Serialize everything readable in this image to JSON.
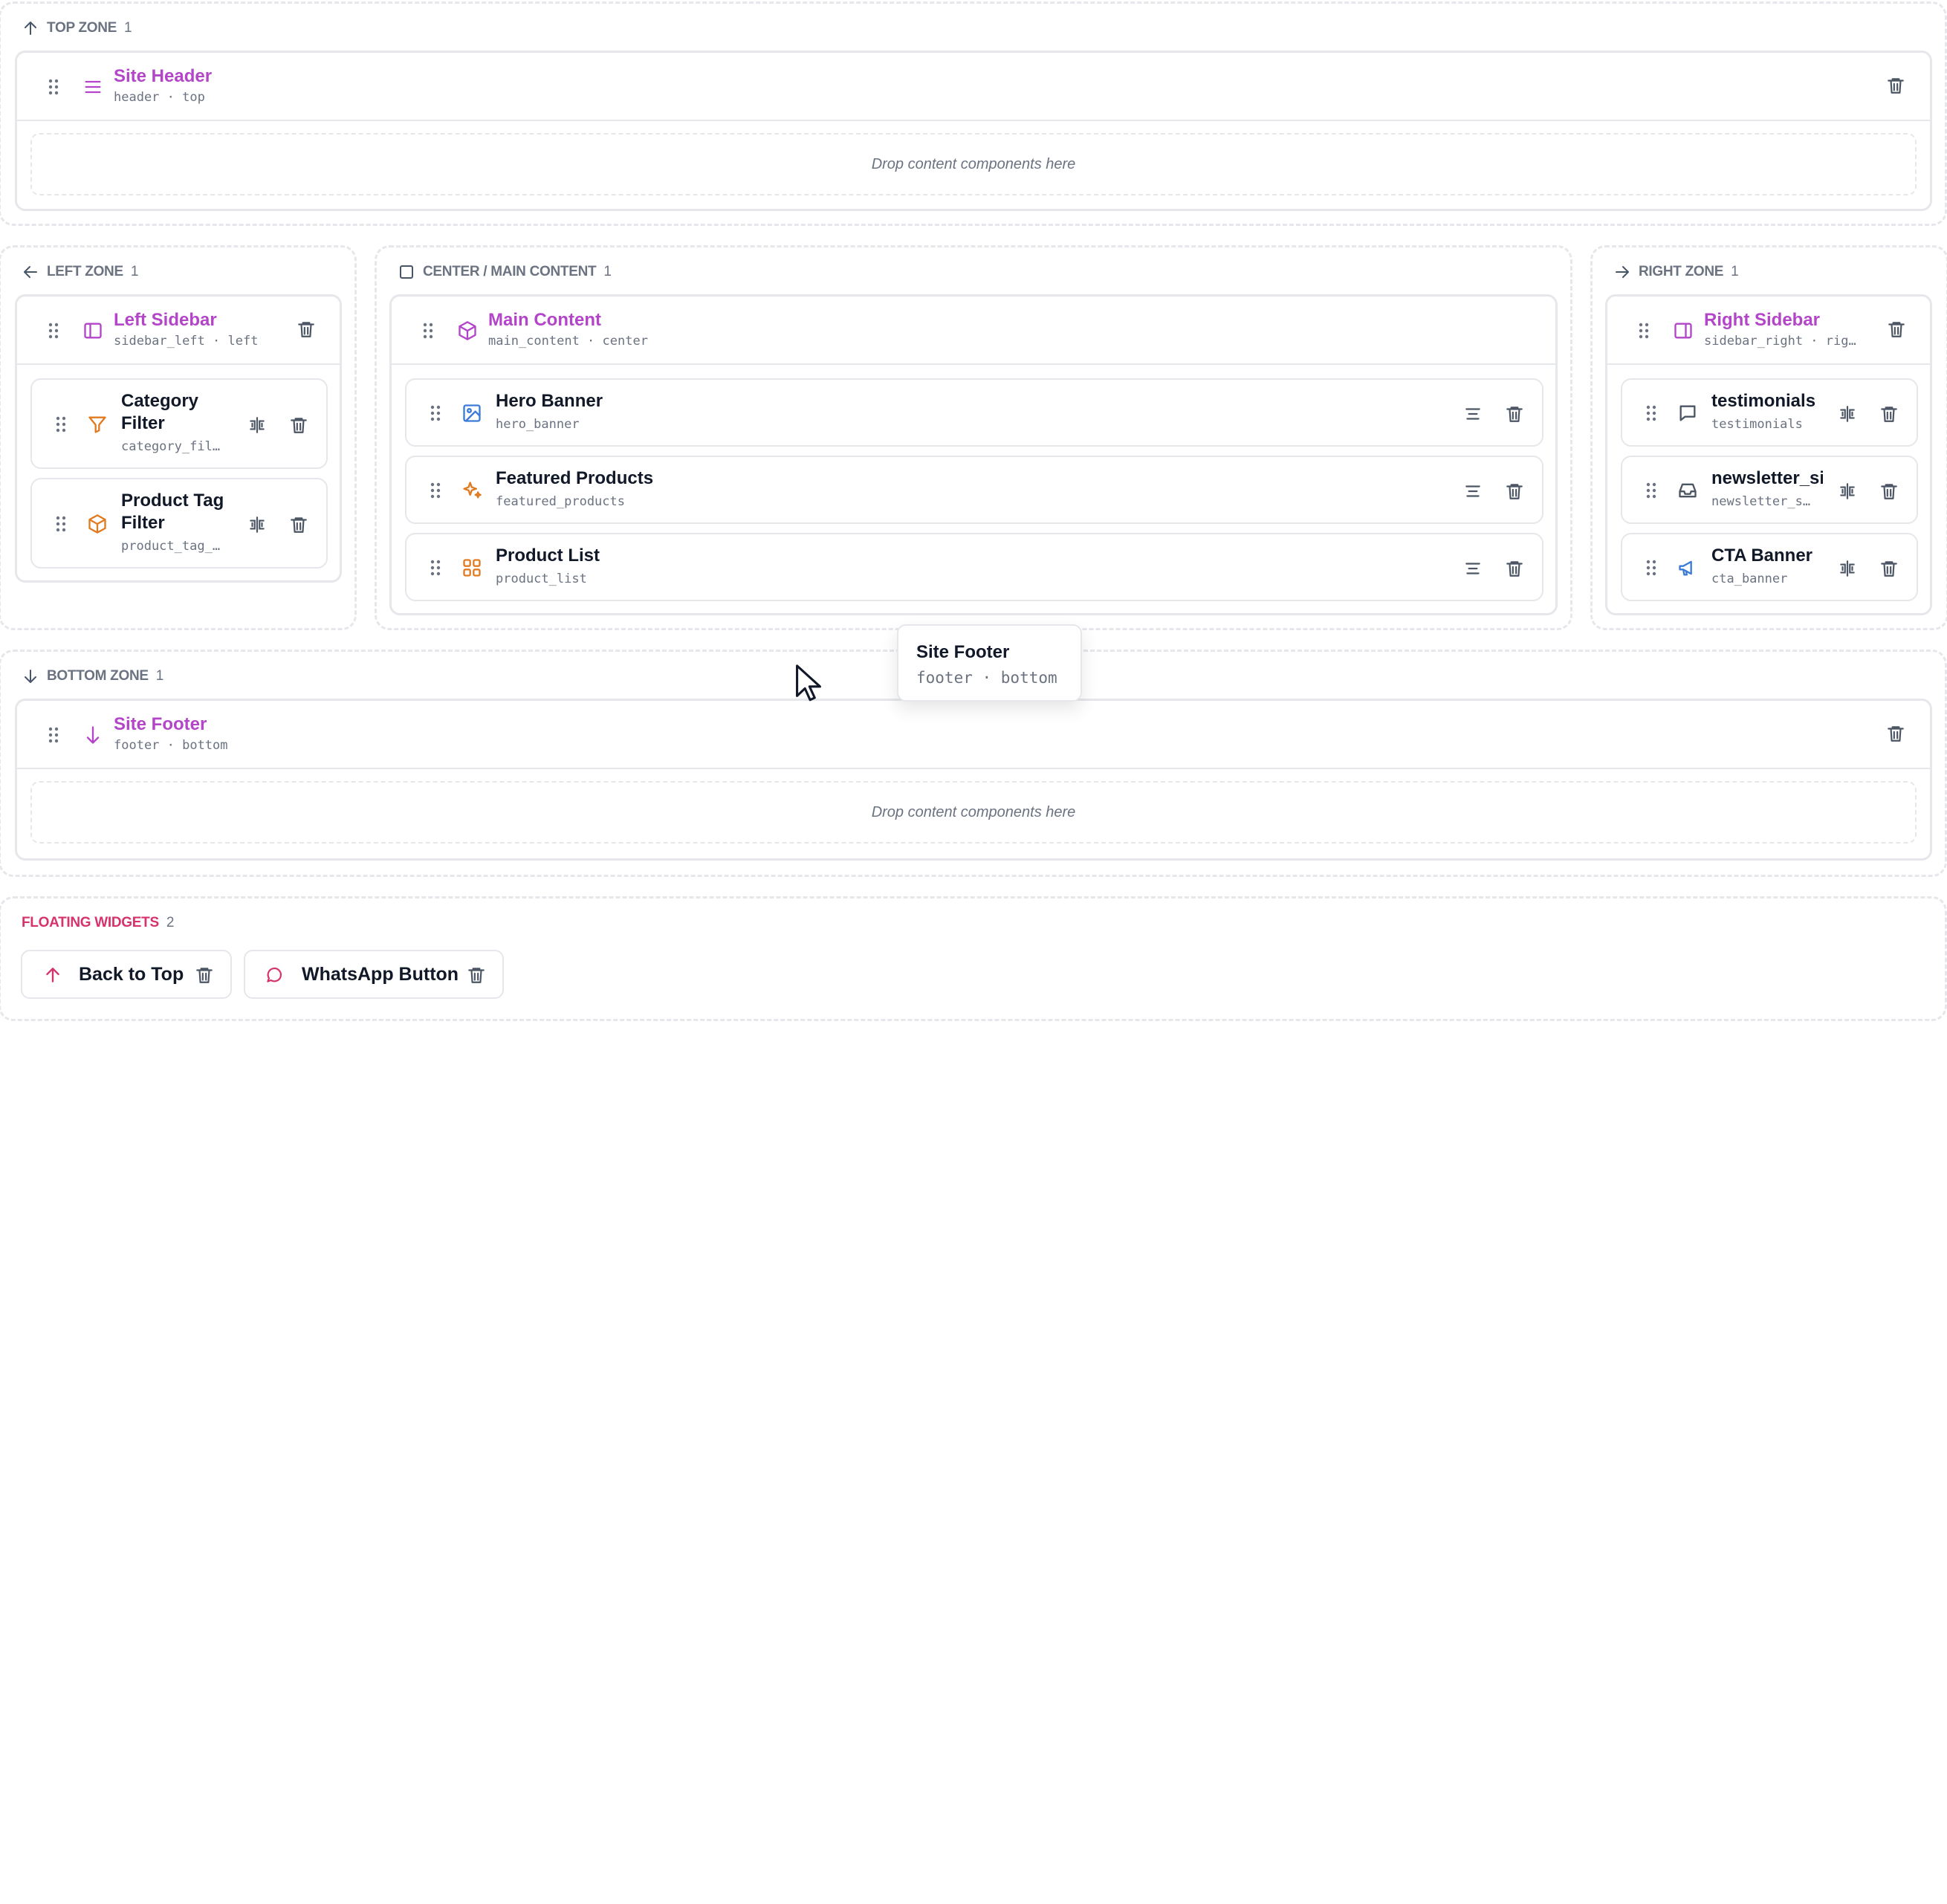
{
  "top_zone": {
    "title": "TOP ZONE",
    "count": "1"
  },
  "site_header": {
    "title": "Site Header",
    "meta": "header · top",
    "drop_text": "Drop content components here"
  },
  "left_zone": {
    "title": "LEFT ZONE",
    "count": "1"
  },
  "left_sidebar": {
    "title": "Left Sidebar",
    "meta": "sidebar_left · left",
    "items": [
      {
        "line1": "Category",
        "line2": "Filter",
        "meta": "category_fil…"
      },
      {
        "line1": "Product Tag",
        "line2": "Filter",
        "meta": "product_tag_…"
      }
    ]
  },
  "center_zone": {
    "title": "CENTER / MAIN CONTENT",
    "count": "1"
  },
  "main_content": {
    "title": "Main Content",
    "meta": "main_content · center",
    "items": [
      {
        "title": "Hero Banner",
        "meta": "hero_banner"
      },
      {
        "title": "Featured Products",
        "meta": "featured_products"
      },
      {
        "title": "Product List",
        "meta": "product_list"
      }
    ]
  },
  "right_zone": {
    "title": "RIGHT ZONE",
    "count": "1"
  },
  "right_sidebar": {
    "title": "Right Sidebar",
    "meta": "sidebar_right · rig…",
    "items": [
      {
        "title": "testimonials",
        "meta": "testimonials"
      },
      {
        "title": "newsletter_si",
        "meta": "newsletter_s…"
      },
      {
        "title": "CTA Banner",
        "meta": "cta_banner"
      }
    ]
  },
  "bottom_zone": {
    "title": "BOTTOM ZONE",
    "count": "1"
  },
  "site_footer": {
    "title": "Site Footer",
    "meta": "footer · bottom",
    "drop_text": "Drop content components here"
  },
  "tooltip": {
    "title": "Site Footer",
    "meta": "footer · bottom"
  },
  "floating": {
    "title": "FLOATING WIDGETS",
    "count": "2",
    "widgets": [
      {
        "label": "Back to Top"
      },
      {
        "label": "WhatsApp Button"
      }
    ]
  },
  "colors": {
    "purple": "#b345c8",
    "orange": "#e07b22",
    "blue": "#3b7bd6",
    "pink": "#d6336c",
    "gray": "#6b7280",
    "border": "#e5e7eb"
  }
}
